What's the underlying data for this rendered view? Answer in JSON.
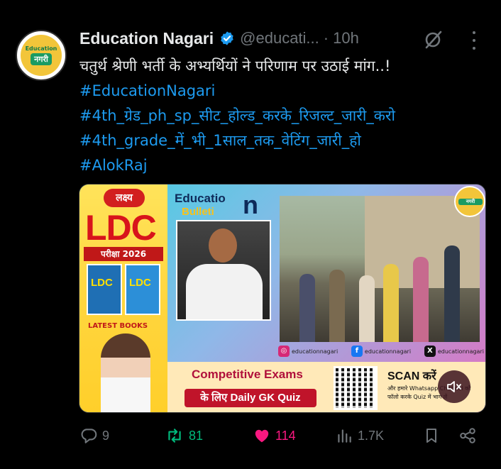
{
  "author": {
    "name": "Education Nagari",
    "handle": "@educati...",
    "separator": "·",
    "time": "10h",
    "avatar_text_top": "Education",
    "avatar_text_main": "नगरी"
  },
  "tweet": {
    "text": "चतुर्थ श्रेणी भर्ती के अभ्यर्थियों ने परिणाम पर उठाई मांग..!",
    "hashtags": [
      "#EducationNagari",
      "#4th_ग्रेड_ph_sp_सीट_होल्ड_करके_रिजल्ट_जारी_करो",
      "#4th_grade_में_भी_1साल_तक_वेटिंग_जारी_हो",
      "#AlokRaj"
    ]
  },
  "media": {
    "lakshya": "लक्ष्य",
    "ldc": "LDC",
    "pariksha": "परीक्षा 2026",
    "book_label": "LDC",
    "latest_books": "LATEST BOOKS",
    "bulletin_education": "Educatio",
    "bulletin_n": "n",
    "bulletin_word": "Bulleti",
    "logo_badge": "नगरी",
    "social": [
      {
        "icon": "instagram-icon",
        "label": "educationnagari"
      },
      {
        "icon": "facebook-icon",
        "label": "educationnagari"
      },
      {
        "icon": "x-icon",
        "label": "educationnagari"
      }
    ],
    "competitive": "Competitive Exams",
    "gk_quiz": "के लिए Daily GK Quiz",
    "scan": "SCAN करें",
    "scan_sub": "और हमारे Whatsapp Channel को फॉलो करके Quiz में भाग लें"
  },
  "actions": {
    "replies": "9",
    "reposts": "81",
    "likes": "114",
    "views": "1.7K"
  },
  "colors": {
    "accent": "#1d9bf0",
    "repost": "#00ba7c",
    "like": "#f91880",
    "muted": "#71767b"
  }
}
